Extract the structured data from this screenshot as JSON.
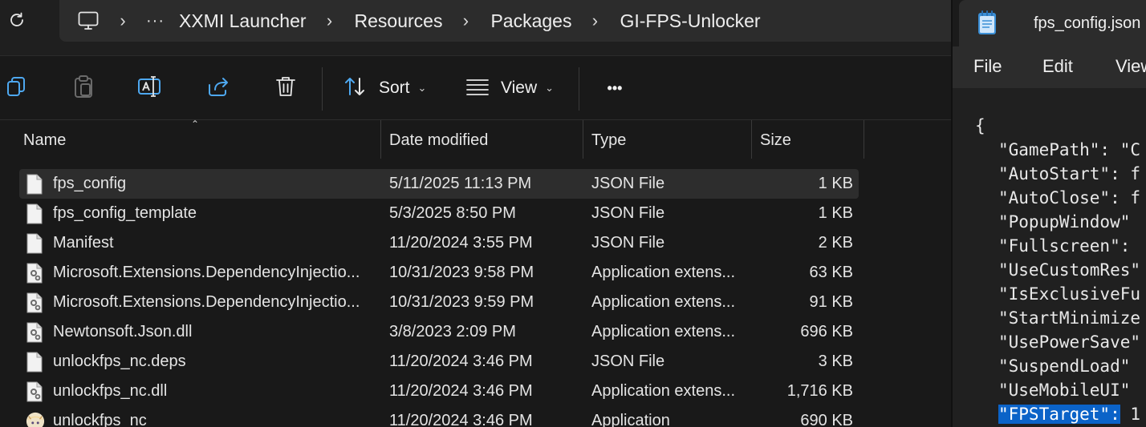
{
  "explorer": {
    "breadcrumb": [
      "XXMI Launcher",
      "Resources",
      "Packages",
      "GI-FPS-Unlocker"
    ],
    "breadcrumb_overflow": "···",
    "toolbar": {
      "sort_label": "Sort",
      "view_label": "View",
      "more_label": "•••"
    },
    "columns": {
      "name": "Name",
      "date": "Date modified",
      "type": "Type",
      "size": "Size"
    },
    "files": [
      {
        "name": "fps_config",
        "date": "5/11/2025 11:13 PM",
        "type": "JSON File",
        "size": "1 KB",
        "icon": "document-icon",
        "selected": true
      },
      {
        "name": "fps_config_template",
        "date": "5/3/2025 8:50 PM",
        "type": "JSON File",
        "size": "1 KB",
        "icon": "document-icon"
      },
      {
        "name": "Manifest",
        "date": "11/20/2024 3:55 PM",
        "type": "JSON File",
        "size": "2 KB",
        "icon": "document-icon"
      },
      {
        "name": "Microsoft.Extensions.DependencyInjectio...",
        "date": "10/31/2023 9:58 PM",
        "type": "Application extens...",
        "size": "63 KB",
        "icon": "dll-gear-icon"
      },
      {
        "name": "Microsoft.Extensions.DependencyInjectio...",
        "date": "10/31/2023 9:59 PM",
        "type": "Application extens...",
        "size": "91 KB",
        "icon": "dll-gear-icon"
      },
      {
        "name": "Newtonsoft.Json.dll",
        "date": "3/8/2023 2:09 PM",
        "type": "Application extens...",
        "size": "696 KB",
        "icon": "dll-gear-icon"
      },
      {
        "name": "unlockfps_nc.deps",
        "date": "11/20/2024 3:46 PM",
        "type": "JSON File",
        "size": "3 KB",
        "icon": "document-icon"
      },
      {
        "name": "unlockfps_nc.dll",
        "date": "11/20/2024 3:46 PM",
        "type": "Application extens...",
        "size": "1,716 KB",
        "icon": "dll-gear-icon"
      },
      {
        "name": "unlockfps_nc",
        "date": "11/20/2024 3:46 PM",
        "type": "Application",
        "size": "690 KB",
        "icon": "app-avatar-icon"
      }
    ]
  },
  "notepad": {
    "tab_title": "fps_config.json",
    "menu": [
      "File",
      "Edit",
      "View"
    ],
    "lines": [
      {
        "text": "{",
        "indent": 0
      },
      {
        "text": "\"GamePath\": \"C",
        "indent": 1
      },
      {
        "text": "\"AutoStart\": f",
        "indent": 1
      },
      {
        "text": "\"AutoClose\": f",
        "indent": 1
      },
      {
        "text": "\"PopupWindow\"",
        "indent": 1
      },
      {
        "text": "\"Fullscreen\":",
        "indent": 1
      },
      {
        "text": "\"UseCustomRes\"",
        "indent": 1
      },
      {
        "text": "\"IsExclusiveFu",
        "indent": 1
      },
      {
        "text": "\"StartMinimize",
        "indent": 1
      },
      {
        "text": "\"UsePowerSave\"",
        "indent": 1
      },
      {
        "text": "\"SuspendLoad\"",
        "indent": 1
      },
      {
        "text": "\"UseMobileUI\"",
        "indent": 1
      },
      {
        "highlight": "\"FPSTarget\":",
        "text": " 1",
        "indent": 1
      }
    ]
  },
  "colors": {
    "background": "#191919",
    "selection_row": "#2d2d2d",
    "text_highlight": "#0b63c8",
    "notepad_icon": "#3b8fd6"
  }
}
